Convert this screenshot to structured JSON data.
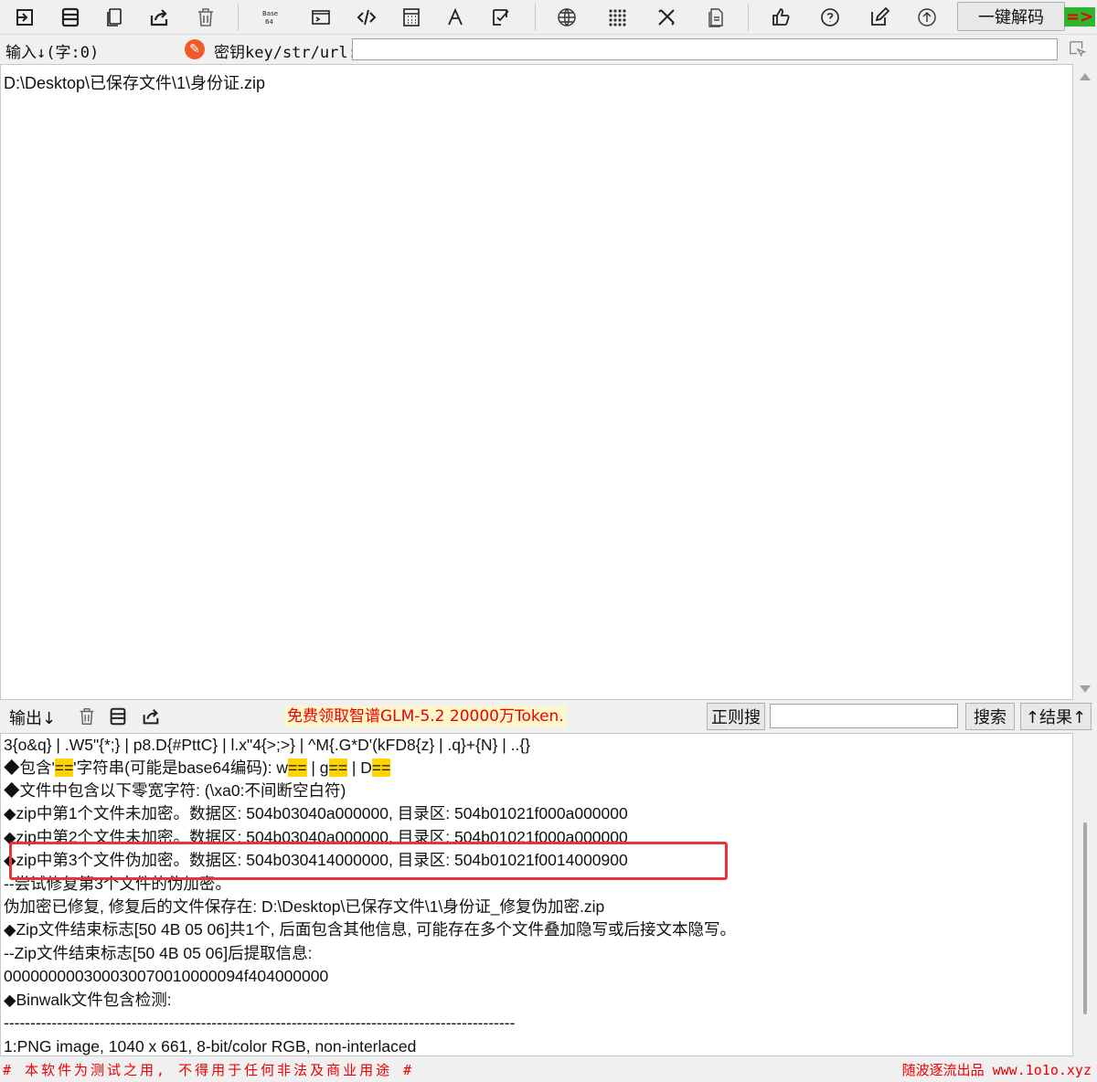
{
  "toolbar": {
    "decode_label": "一键解码",
    "arrow_label": "=>",
    "buttons": [
      "import-icon",
      "save-icon",
      "copy-icon",
      "share-icon",
      "trash-icon",
      "base64-icon",
      "terminal-icon",
      "code-icon",
      "calculator-icon",
      "font-icon",
      "edit-check-icon",
      "globe-icon",
      "grid-icon",
      "tools-icon",
      "document-icon",
      "thumbs-up-icon",
      "help-icon",
      "pen-icon",
      "upload-icon"
    ],
    "base_text": "Base\n64"
  },
  "input_bar": {
    "label": "输入↓(字:0)",
    "key_label": "密钥key/str/url:",
    "key_value": ""
  },
  "input_text": "D:\\Desktop\\已保存文件\\1\\身份证.zip",
  "output_bar": {
    "label": "输出↓",
    "promo": "免费领取智谱GLM-5.2  20000万Token.",
    "regex_label": "正则搜",
    "search_value": "",
    "search_label": "搜索",
    "result_label": "↑结果↑"
  },
  "output_lines": [
    {
      "parts": [
        {
          "t": "3{o&q} | .W5\"{*;} | p8.D{#PttC} | l.x\"4{>;>} | ^M{.G*D'(kFD8{z} | .q}+{N} | ..{}"
        }
      ]
    },
    {
      "parts": [
        {
          "t": "◆包含'"
        },
        {
          "t": "==",
          "hl": true
        },
        {
          "t": "'字符串(可能是base64编码):  w"
        },
        {
          "t": "==",
          "hl": true
        },
        {
          "t": " | g"
        },
        {
          "t": "==",
          "hl": true
        },
        {
          "t": " | D"
        },
        {
          "t": "==",
          "hl": true
        }
      ]
    },
    {
      "parts": [
        {
          "t": "◆文件中包含以下零宽字符: (\\xa0:不间断空白符)"
        }
      ]
    },
    {
      "parts": [
        {
          "t": "◆zip中第1个文件未加密。数据区: 504b03040a000000, 目录区: 504b01021f000a000000"
        }
      ]
    },
    {
      "parts": [
        {
          "t": "◆zip中第2个文件未加密。数据区: 504b03040a000000, 目录区: 504b01021f000a000000"
        }
      ]
    },
    {
      "parts": [
        {
          "t": "◆zip中第3个文件伪加密。数据区: 504b030414000000, 目录区: 504b01021f0014000900"
        }
      ]
    },
    {
      "parts": [
        {
          "t": "--尝试修复第3个文件的伪加密。"
        }
      ]
    },
    {
      "parts": [
        {
          "t": "伪加密已修复, 修复后的文件保存在: D:\\Desktop\\已保存文件\\1\\身份证_修复伪加密.zip"
        }
      ]
    },
    {
      "parts": [
        {
          "t": "◆Zip文件结束标志[50 4B 05 06]共1个, 后面包含其他信息, 可能存在多个文件叠加隐写或后接文本隐写。"
        }
      ]
    },
    {
      "parts": [
        {
          "t": "--Zip文件结束标志[50 4B 05 06]后提取信息:"
        }
      ]
    },
    {
      "parts": [
        {
          "t": "000000000300030070010000094f404000000"
        }
      ]
    },
    {
      "parts": [
        {
          "t": "◆Binwalk文件包含检测:"
        }
      ]
    },
    {
      "parts": [
        {
          "t": "------------------------------------------------------------------------------------------------"
        }
      ]
    },
    {
      "parts": [
        {
          "t": "1:PNG image, 1040 x 661, 8-bit/color RGB, non-interlaced"
        }
      ]
    }
  ],
  "footer": {
    "left": "# 本软件为测试之用, 不得用于任何非法及商业用途 #",
    "right": "随波逐流出品 www.1o1o.xyz"
  }
}
